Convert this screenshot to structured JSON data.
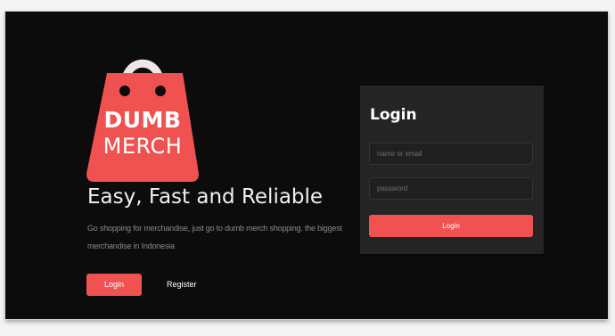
{
  "brand": {
    "name_line_1": "DUMB",
    "name_line_2": "MERCH",
    "logo_icon": "shopping-bag-icon"
  },
  "hero": {
    "headline": "Easy, Fast and Reliable",
    "description": "Go shopping for merchandise, just go to dumb merch shopping. the biggest merchandise in Indonesia",
    "login_label": "Login",
    "register_label": "Register"
  },
  "login_form": {
    "title": "Login",
    "email_placeholder": "name or email",
    "password_placeholder": "password",
    "submit_label": "Login"
  },
  "colors": {
    "background": "#0c0c0c",
    "panel": "#242424",
    "accent": "#f05252",
    "text": "#ffffff",
    "muted_text": "#8a8a8a"
  }
}
